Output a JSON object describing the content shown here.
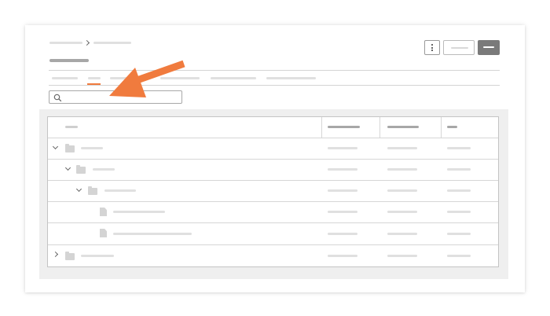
{
  "colors": {
    "accent": "#f07b3e",
    "placeholder": "#e0e0e0",
    "button_primary": "#7a7a7a",
    "border": "#c4c4c4",
    "panel_background": "#efefef"
  },
  "header": {
    "breadcrumb_separator": "›",
    "kebab_icon": "vertical-ellipsis-icon"
  },
  "search": {
    "icon": "search-icon",
    "value": "",
    "placeholder": ""
  },
  "annotation": {
    "icon": "arrow-pointer-icon",
    "color": "#f07b3e"
  },
  "table": {
    "rows": [
      {
        "type": "folder",
        "level": 0,
        "expanded": true
      },
      {
        "type": "folder",
        "level": 1,
        "expanded": true
      },
      {
        "type": "folder",
        "level": 2,
        "expanded": true
      },
      {
        "type": "file",
        "level": 3
      },
      {
        "type": "file",
        "level": 3
      },
      {
        "type": "folder",
        "level": 0,
        "expanded": false
      }
    ]
  }
}
